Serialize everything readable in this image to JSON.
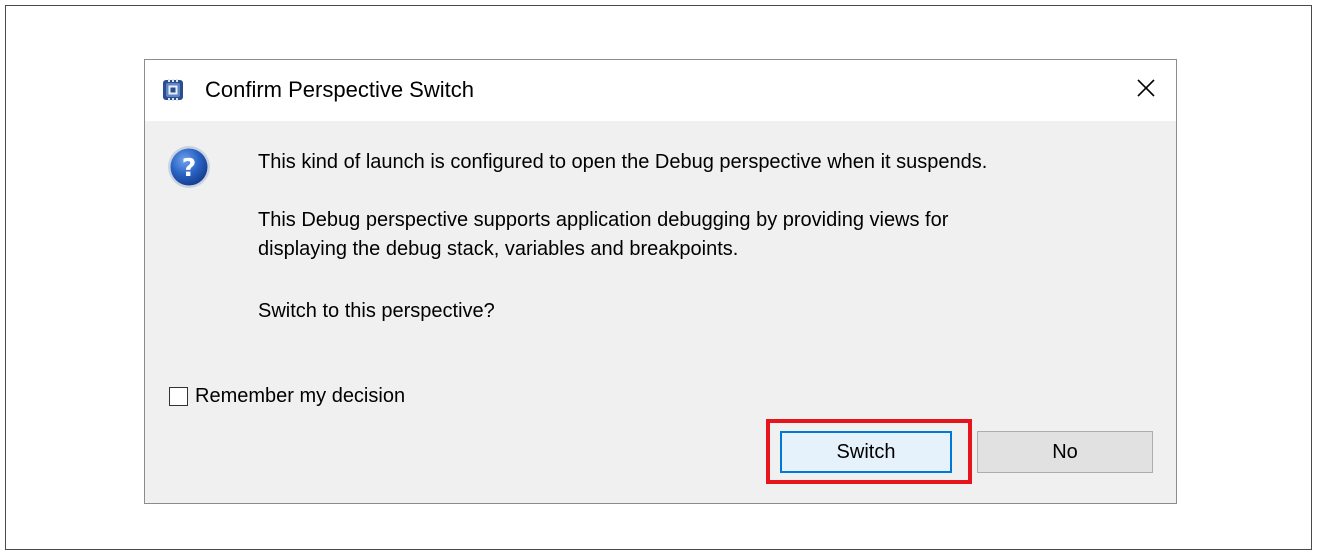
{
  "dialog": {
    "title": "Confirm Perspective Switch",
    "app_icon": "chip-app-icon",
    "close_icon": "close-icon",
    "question_icon": "question-icon",
    "message_line_1": "This kind of launch is configured to open the Debug perspective when it suspends.",
    "message_line_2": "This Debug perspective supports application debugging by providing views for",
    "message_line_3": "displaying the debug stack, variables and breakpoints.",
    "message_line_4": "Switch to this perspective?",
    "remember_checkbox": {
      "label": "Remember my decision",
      "checked": false
    },
    "buttons": {
      "switch_label": "Switch",
      "no_label": "No"
    }
  },
  "annotation": {
    "highlight_color": "#e8141c",
    "highlight_target": "switch-button"
  },
  "colors": {
    "dialog_background": "#f0f0f0",
    "titlebar_background": "#ffffff",
    "default_button_border": "#0078d7",
    "default_button_fill": "#e5f1fb",
    "button_fill": "#e1e1e1"
  }
}
